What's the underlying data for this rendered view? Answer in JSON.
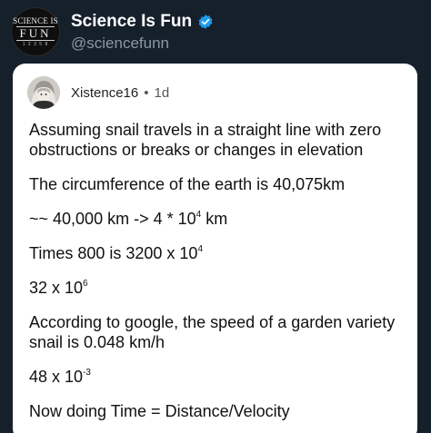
{
  "post": {
    "logo": {
      "line1": "SCIENCE IS",
      "line2": "FUN",
      "line3": "1 2 3 5 8"
    },
    "author_name": "Science Is Fun",
    "author_handle": "@sciencefunn",
    "verified_icon": "verified-badge-icon",
    "accent_color": "#1d9bf0"
  },
  "card": {
    "username": "Xistence16",
    "separator": "•",
    "age": "1d",
    "paragraphs": {
      "p1": "Assuming snail travels in a straight line with zero obstructions or breaks or changes in elevation",
      "p2": "The circumference of the earth is 40,075km",
      "p3_pre": "~~ 40,000 km -> 4 * 10",
      "p3_sup": "4",
      "p3_post": " km",
      "p4_pre": "Times 800 is 3200 x 10",
      "p4_sup": "4",
      "p5_pre": "32 x 10",
      "p5_sup": "6",
      "p6": "According to google, the speed of a garden variety snail is 0.048 km/h",
      "p7_pre": "48 x 10",
      "p7_sup": "-3",
      "p8": "Now doing Time = Distance/Velocity"
    }
  }
}
